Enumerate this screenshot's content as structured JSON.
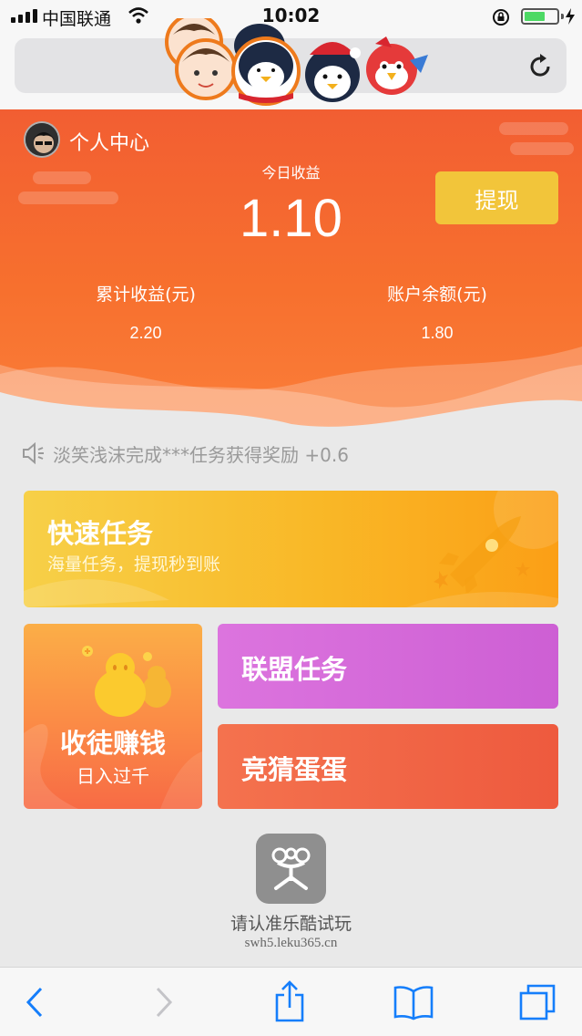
{
  "status_bar": {
    "carrier": "中国联通",
    "time": "10:02",
    "battery_level": 0.65
  },
  "url_bar": {
    "reload_icon": "reload-icon"
  },
  "header": {
    "profile_label": "个人中心",
    "today_label": "今日收益",
    "today_value": "1.10",
    "withdraw_label": "提现",
    "total_label": "累计收益(元)",
    "total_value": "2.20",
    "balance_label": "账户余额(元)",
    "balance_value": "1.80"
  },
  "notice": {
    "icon": "speaker-icon",
    "text": "淡笑浅沫完成***任务获得奖励 +0.6"
  },
  "cards": {
    "quick": {
      "title": "快速任务",
      "subtitle": "海量任务，提现秒到账"
    },
    "recruit": {
      "title": "收徒赚钱",
      "subtitle": "日入过千"
    },
    "alliance": {
      "title": "联盟任务"
    },
    "guess": {
      "title": "竞猜蛋蛋"
    }
  },
  "app": {
    "name": "请认准乐酷试玩",
    "domain": "swh5.leku365.cn"
  },
  "toolbar": {
    "icons": [
      "back-icon",
      "forward-icon",
      "share-icon",
      "bookmarks-icon",
      "tabs-icon"
    ]
  },
  "colors": {
    "header_orange": "#f25e32",
    "withdraw_yellow": "#f2c53a",
    "ios_blue": "#157efb",
    "quick_card": "#f9b827",
    "alliance_card": "#d36ad8",
    "guess_card": "#f06345"
  }
}
